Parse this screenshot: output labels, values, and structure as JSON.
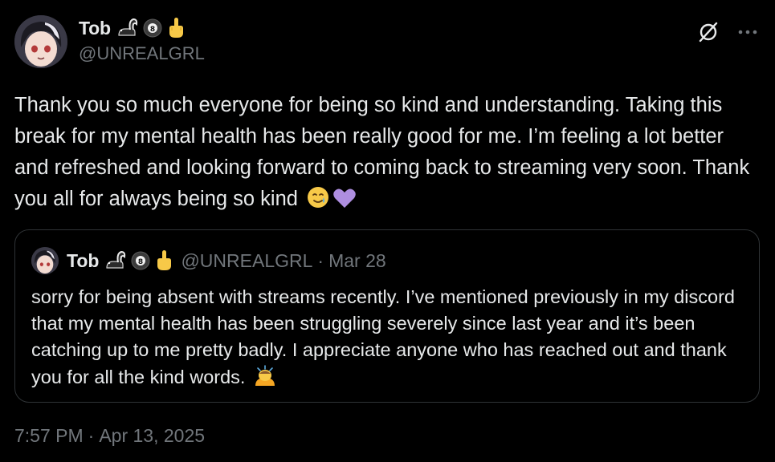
{
  "author": {
    "name": "Tob",
    "handle": "@UNREALGRL",
    "badges": [
      "skunk-icon",
      "eight-ball-icon",
      "middle-finger-icon"
    ]
  },
  "tweet": {
    "text": "Thank you so much everyone for being so kind and understanding. Taking this break for my mental health has been really good for me. I’m feeling a lot better and refreshed and looking forward to coming back to streaming very soon. Thank you all for always being so kind",
    "trailing_emojis": [
      "smiling-face-with-tear-icon",
      "purple-heart-icon"
    ],
    "time": "7:57 PM",
    "separator": "·",
    "date": "Apr 13, 2025"
  },
  "quoted_tweet": {
    "name": "Tob",
    "handle": "@UNREALGRL",
    "separator": "·",
    "date": "Mar 28",
    "text": "sorry for being absent with streams recently. I’ve mentioned previously in my discord that my mental health has been struggling severely since last year and it’s been catching up to me pretty badly. I appreciate anyone who has reached out and thank you for all the kind words.",
    "trailing_emojis": [
      "person-bowing-icon"
    ]
  },
  "actions": {
    "icons": [
      "grok-icon",
      "more-icon"
    ]
  },
  "colors": {
    "background": "#000000",
    "text_primary": "#e7e9ea",
    "text_secondary": "#71767b",
    "border": "#2f3336"
  }
}
